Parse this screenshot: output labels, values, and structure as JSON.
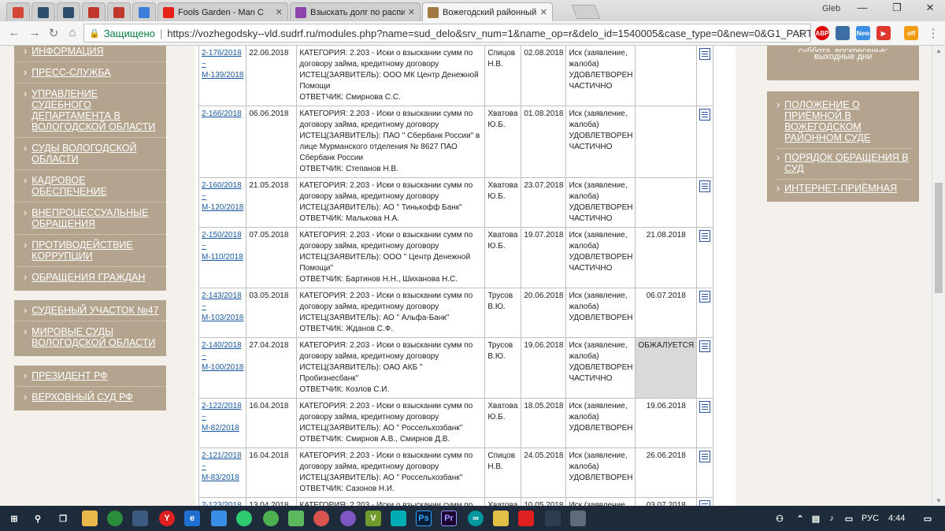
{
  "browser": {
    "tabs": [
      {
        "icon": "gmail-icon",
        "title": "",
        "pinned": true,
        "color": "#d44638"
      },
      {
        "icon": "site-icon",
        "title": "",
        "pinned": true,
        "color": "#2f4f6f"
      },
      {
        "icon": "site-icon",
        "title": "",
        "pinned": true,
        "color": "#2f4f6f"
      },
      {
        "icon": "scales-icon",
        "title": "",
        "pinned": true,
        "color": "#c0392b"
      },
      {
        "icon": "scales-icon",
        "title": "",
        "pinned": true,
        "color": "#c0392b"
      },
      {
        "icon": "chat-icon",
        "title": "",
        "pinned": true,
        "color": "#3b7dd8"
      },
      {
        "icon": "youtube-icon",
        "title": "Fools Garden - Man C",
        "pinned": false,
        "color": "#e62117"
      },
      {
        "icon": "court-icon",
        "title": "Взыскать долг по распи",
        "pinned": false,
        "color": "#8e44ad"
      },
      {
        "icon": "court-icon",
        "title": "Вожегодский районный",
        "pinned": false,
        "color": "#a07a40",
        "active": true
      }
    ],
    "profile_name": "Gleb",
    "secure_label": "Защищено",
    "url": "https://vozhegodsky--vld.sudrf.ru/modules.php?name=sud_delo&srv_num=1&name_op=r&delo_id=1540005&case_type=0&new=0&G1_PART..."
  },
  "left_nav": {
    "blocks": [
      {
        "items": [
          {
            "label": "ИНФОРМАЦИЯ"
          },
          {
            "label": "ПРЕСС-СЛУЖБА"
          },
          {
            "label": "УПРАВЛЕНИЕ СУДЕБНОГО ДЕПАРТАМЕНТА В ВОЛОГОДСКОЙ ОБЛАСТИ"
          },
          {
            "label": "СУДЫ ВОЛОГОДСКОЙ ОБЛАСТИ"
          },
          {
            "label": "КАДРОВОЕ ОБЕСПЕЧЕНИЕ"
          },
          {
            "label": "ВНЕПРОЦЕССУАЛЬНЫЕ ОБРАЩЕНИЯ"
          },
          {
            "label": "ПРОТИВОДЕЙСТВИЕ КОРРУПЦИИ"
          },
          {
            "label": "ОБРАЩЕНИЯ ГРАЖДАН"
          }
        ]
      },
      {
        "items": [
          {
            "label": "СУДЕБНЫЙ УЧАСТОК №47"
          },
          {
            "label": "МИРОВЫЕ СУДЫ ВОЛОГОДСКОЙ ОБЛАСТИ"
          }
        ]
      },
      {
        "items": [
          {
            "label": "ПРЕЗИДЕНТ РФ"
          },
          {
            "label": "ВЕРХОВНЫЙ СУД РФ"
          }
        ]
      }
    ]
  },
  "cases": [
    {
      "num": "2-176/2018",
      "sub": "~",
      "mnum": "М-139/2018",
      "date": "22.06.2018",
      "category": "КАТЕГОРИЯ: 2.203 - Иски о взыскании сумм по договору займа, кредитному договору",
      "plaintiff": "ИСТЕЦ(ЗАЯВИТЕЛЬ): ООО МК Центр Денежной Помощи",
      "defendant": "ОТВЕТЧИК: Смирнова С.С.",
      "judge": "Спицов Н.В.",
      "date2": "02.08.2018",
      "result": "Иск (заявление, жалоба) УДОВЛЕТВОРЕН ЧАСТИЧНО",
      "appeal": "",
      "grey": false
    },
    {
      "num": "2-166/2018",
      "sub": "",
      "mnum": "",
      "date": "06.06.2018",
      "category": "КАТЕГОРИЯ: 2.203 - Иски о взыскании сумм по договору займа, кредитному договору",
      "plaintiff": "ИСТЕЦ(ЗАЯВИТЕЛЬ): ПАО \" Сбербанк России\" в лице Мурманского отделения № 8627 ПАО Сбербанк России",
      "defendant": "ОТВЕТЧИК: Степанов Н.В.",
      "judge": "Хватова Ю.Б.",
      "date2": "01.08.2018",
      "result": "Иск (заявление, жалоба) УДОВЛЕТВОРЕН ЧАСТИЧНО",
      "appeal": "",
      "grey": false
    },
    {
      "num": "2-160/2018",
      "sub": "~",
      "mnum": "М-120/2018",
      "date": "21.05.2018",
      "category": "КАТЕГОРИЯ: 2.203 - Иски о взыскании сумм по договору займа, кредитному договору",
      "plaintiff": "ИСТЕЦ(ЗАЯВИТЕЛЬ): АО \" Тинькофф Банк\"",
      "defendant": "ОТВЕТЧИК: Малькова Н.А.",
      "judge": "Хватова Ю.Б.",
      "date2": "23.07.2018",
      "result": "Иск (заявление, жалоба) УДОВЛЕТВОРЕН ЧАСТИЧНО",
      "appeal": "",
      "grey": false
    },
    {
      "num": "2-150/2018",
      "sub": "~",
      "mnum": "М-110/2018",
      "date": "07.05.2018",
      "category": "КАТЕГОРИЯ: 2.203 - Иски о взыскании сумм по договору займа, кредитному договору",
      "plaintiff": "ИСТЕЦ(ЗАЯВИТЕЛЬ): ООО \" Центр Денежной Помощи\"",
      "defendant": "ОТВЕТЧИК: Бартинов Н.Н., Шиханова Н.С.",
      "judge": "Хватова Ю.Б.",
      "date2": "19.07.2018",
      "result": "Иск (заявление, жалоба) УДОВЛЕТВОРЕН ЧАСТИЧНО",
      "appeal": "21.08.2018",
      "grey": false
    },
    {
      "num": "2-143/2018",
      "sub": "~",
      "mnum": "М-103/2018",
      "date": "03.05.2018",
      "category": "КАТЕГОРИЯ: 2.203 - Иски о взыскании сумм по договору займа, кредитному договору",
      "plaintiff": "ИСТЕЦ(ЗАЯВИТЕЛЬ): АО \" Альфа-Банк\"",
      "defendant": "ОТВЕТЧИК: Жданов С.Ф.",
      "judge": "Трусов В.Ю.",
      "date2": "20.06.2018",
      "result": "Иск (заявление, жалоба) УДОВЛЕТВОРЕН",
      "appeal": "06.07.2018",
      "grey": false
    },
    {
      "num": "2-140/2018",
      "sub": "~",
      "mnum": "М-100/2018",
      "date": "27.04.2018",
      "category": "КАТЕГОРИЯ: 2.203 - Иски о взыскании сумм по договору займа, кредитному договору",
      "plaintiff": "ИСТЕЦ(ЗАЯВИТЕЛЬ): ОАО АКБ \" Пробизнесбанк\"",
      "defendant": "ОТВЕТЧИК: Козлов С.И.",
      "judge": "Трусов В.Ю.",
      "date2": "19.06.2018",
      "result": "Иск (заявление, жалоба) УДОВЛЕТВОРЕН ЧАСТИЧНО",
      "appeal": "ОБЖАЛУЕТСЯ",
      "grey": true
    },
    {
      "num": "2-122/2018",
      "sub": "~",
      "mnum": "М-82/2018",
      "date": "16.04.2018",
      "category": "КАТЕГОРИЯ: 2.203 - Иски о взыскании сумм по договору займа, кредитному договору",
      "plaintiff": "ИСТЕЦ(ЗАЯВИТЕЛЬ): АО \" Россельхозбанк\"",
      "defendant": "ОТВЕТЧИК: Смирнов А.В., Смирнов Д.В.",
      "judge": "Хватова Ю.Б.",
      "date2": "18.05.2018",
      "result": "Иск (заявление, жалоба) УДОВЛЕТВОРЕН",
      "appeal": "19.06.2018",
      "grey": false
    },
    {
      "num": "2-121/2018",
      "sub": "~",
      "mnum": "М-83/2018",
      "date": "16.04.2018",
      "category": "КАТЕГОРИЯ: 2.203 - Иски о взыскании сумм по договору займа, кредитному договору",
      "plaintiff": "ИСТЕЦ(ЗАЯВИТЕЛЬ): АО \" Россельхозбанк\"",
      "defendant": "ОТВЕТЧИК: Сазонов Н.И.",
      "judge": "Спицов Н.В.",
      "date2": "24.05.2018",
      "result": "Иск (заявление, жалоба) УДОВЛЕТВОРЕН",
      "appeal": "26.06.2018",
      "grey": false
    },
    {
      "num": "2-123/2018",
      "sub": "",
      "mnum": "",
      "date": "13.04.2018",
      "category": "КАТЕГОРИЯ: 2.203 - Иски о взыскании сумм по",
      "plaintiff": "",
      "defendant": "",
      "judge": "Хватова",
      "date2": "10.05.2018",
      "result": "Иск (заявление,",
      "appeal": "03.07.2018",
      "grey": false
    }
  ],
  "right_col": {
    "schedule_text_cut": "суббота, воскресенье:",
    "schedule_text": "выходные дни",
    "items": [
      {
        "label": "ПОЛОЖЕНИЕ О ПРИЁМНОЙ В ВОЖЕГОДСКОМ РАЙОННОМ СУДЕ"
      },
      {
        "label": "ПОРЯДОК ОБРАЩЕНИЯ В СУД"
      },
      {
        "label": "ИНТЕРНЕТ-ПРИЁМНАЯ"
      }
    ]
  },
  "taskbar": {
    "language": "РУС",
    "time": "4:44"
  },
  "colors": {
    "nav_bg": "#b5a48d",
    "page_bg": "#f4f0ec",
    "link": "#1a5aa5",
    "secure_green": "#0b8043",
    "taskbar_bg": "#1e2b3a"
  }
}
